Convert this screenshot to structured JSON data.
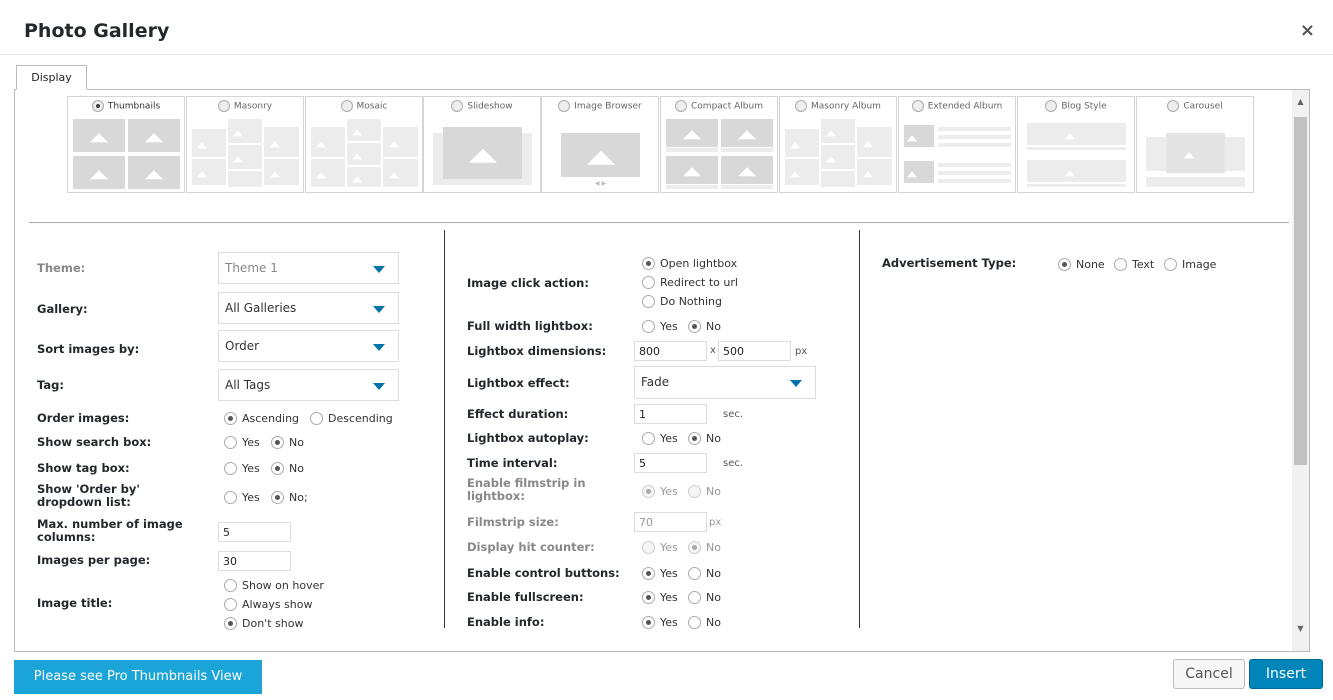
{
  "dialog": {
    "title": "Photo Gallery",
    "close": "×"
  },
  "tabs": [
    {
      "label": "Display"
    }
  ],
  "views": [
    {
      "label": "Thumbnails",
      "selected": true
    },
    {
      "label": "Masonry",
      "selected": false
    },
    {
      "label": "Mosaic",
      "selected": false
    },
    {
      "label": "Slideshow",
      "selected": false
    },
    {
      "label": "Image Browser",
      "selected": false
    },
    {
      "label": "Compact Album",
      "selected": false
    },
    {
      "label": "Masonry Album",
      "selected": false
    },
    {
      "label": "Extended Album",
      "selected": false
    },
    {
      "label": "Blog Style",
      "selected": false
    },
    {
      "label": "Carousel",
      "selected": false
    }
  ],
  "image_browser_nav": "◀ ▶",
  "left": {
    "theme": {
      "label": "Theme:",
      "value": "Theme 1"
    },
    "gallery": {
      "label": "Gallery:",
      "value": "All Galleries"
    },
    "sort": {
      "label": "Sort images by:",
      "value": "Order"
    },
    "tag": {
      "label": "Tag:",
      "value": "All Tags"
    },
    "order": {
      "label": "Order images:",
      "options": [
        "Ascending",
        "Descending"
      ],
      "selected": 0
    },
    "search_box": {
      "label": "Show search box:",
      "options": [
        "Yes",
        "No"
      ],
      "selected": 1
    },
    "tag_box": {
      "label": "Show tag box:",
      "options": [
        "Yes",
        "No"
      ],
      "selected": 1
    },
    "order_by": {
      "label1": "Show 'Order by'",
      "label2": "dropdown list:",
      "options": [
        "Yes",
        "No;"
      ],
      "selected": 1
    },
    "max_cols": {
      "label1": "Max. number of image",
      "label2": "columns:",
      "value": "5"
    },
    "per_page": {
      "label": "Images per page:",
      "value": "30"
    },
    "image_title": {
      "label": "Image title:",
      "options": [
        "Show on hover",
        "Always show",
        "Don't show"
      ],
      "selected": 2
    }
  },
  "middle": {
    "click_action": {
      "label": "Image click action:",
      "options": [
        "Open lightbox",
        "Redirect to url",
        "Do Nothing"
      ],
      "selected": 0
    },
    "full_width": {
      "label": "Full width lightbox:",
      "options": [
        "Yes",
        "No"
      ],
      "selected": 1
    },
    "dimensions": {
      "label": "Lightbox dimensions:",
      "width": "800",
      "sep": "x",
      "height": "500",
      "unit": "px"
    },
    "effect": {
      "label": "Lightbox effect:",
      "value": "Fade"
    },
    "duration": {
      "label": "Effect duration:",
      "value": "1",
      "unit": "sec."
    },
    "autoplay": {
      "label": "Lightbox autoplay:",
      "options": [
        "Yes",
        "No"
      ],
      "selected": 1
    },
    "interval": {
      "label": "Time interval:",
      "value": "5",
      "unit": "sec."
    },
    "filmstrip": {
      "label1": "Enable filmstrip in",
      "label2": "lightbox:",
      "options": [
        "Yes",
        "No"
      ],
      "selected": 0
    },
    "filmstrip_size": {
      "label": "Filmstrip size:",
      "value": "70",
      "unit": "px"
    },
    "hit_counter": {
      "label": "Display hit counter:",
      "options": [
        "Yes",
        "No"
      ],
      "selected": 1
    },
    "control_buttons": {
      "label": "Enable control buttons:",
      "options": [
        "Yes",
        "No"
      ],
      "selected": 0
    },
    "fullscreen": {
      "label": "Enable fullscreen:",
      "options": [
        "Yes",
        "No"
      ],
      "selected": 0
    },
    "info": {
      "label": "Enable info:",
      "options": [
        "Yes",
        "No"
      ],
      "selected": 0
    }
  },
  "right": {
    "ad_type": {
      "label": "Advertisement Type:",
      "options": [
        "None",
        "Text",
        "Image"
      ],
      "selected": 0
    }
  },
  "footer": {
    "pro": "Please see Pro Thumbnails View",
    "cancel": "Cancel",
    "insert": "Insert"
  }
}
